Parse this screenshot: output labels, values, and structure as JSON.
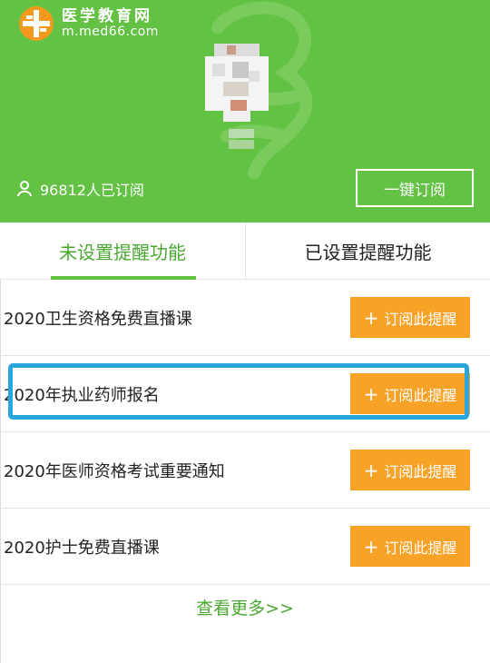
{
  "header": {
    "logo": {
      "name": "医学教育网",
      "url": "m.med66.com"
    },
    "subscribers_text": "96812人已订阅",
    "one_key_button": "一键订阅",
    "bg_color": "#63c143"
  },
  "tabs": [
    {
      "label": "未设置提醒功能",
      "active": true
    },
    {
      "label": "已设置提醒功能",
      "active": false
    }
  ],
  "list": [
    {
      "title": "2020卫生资格免费直播课",
      "button": "订阅此提醒"
    },
    {
      "title": "2020年执业药师报名",
      "button": "订阅此提醒"
    },
    {
      "title": "2020年医师资格考试重要通知",
      "button": "订阅此提醒"
    },
    {
      "title": "2020护士免费直播课",
      "button": "订阅此提醒"
    }
  ],
  "more_link": "查看更多>>",
  "colors": {
    "accent_green": "#63c143",
    "button_orange": "#f8a227",
    "highlight_blue": "#2aa6df"
  }
}
